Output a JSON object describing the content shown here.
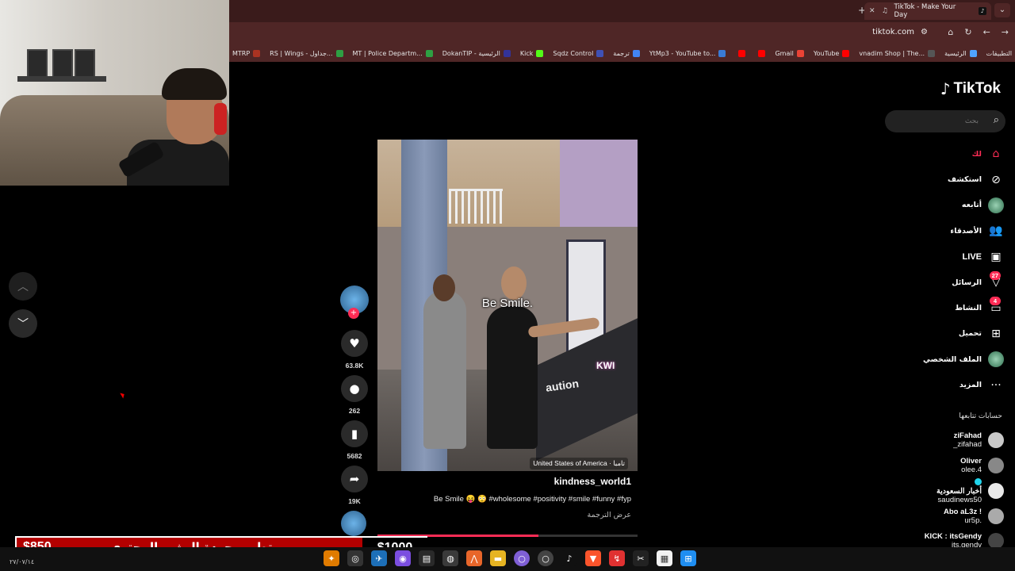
{
  "browser": {
    "tab_title": "TikTok - Make Your Day",
    "url": "tiktok.com",
    "bookmarks": [
      {
        "label": "التطبيقات",
        "color": "#8888ff"
      },
      {
        "label": "الرئيسية",
        "color": "#4fa3ff"
      },
      {
        "label": "vnadim Shop | The...",
        "color": "#555555"
      },
      {
        "label": "YouTube",
        "color": "#ff0000"
      },
      {
        "label": "Gmail",
        "color": "#ea4335"
      },
      {
        "label": "",
        "color": "#ff0000"
      },
      {
        "label": "",
        "color": "#ff0000"
      },
      {
        "label": "YtMp3 - YouTube to...",
        "color": "#3a7bd5"
      },
      {
        "label": "ترجمة",
        "color": "#4285f4"
      },
      {
        "label": "Sqdz Control",
        "color": "#3f51b5"
      },
      {
        "label": "Kick",
        "color": "#53fc18"
      },
      {
        "label": "DokanTIP - الرئيسية",
        "color": "#333399"
      },
      {
        "label": "MT | Police Departm...",
        "color": "#2ea043"
      },
      {
        "label": "RS | Wings - جداول...",
        "color": "#2ea043"
      },
      {
        "label": "MTRP",
        "color": "#aa3322"
      }
    ]
  },
  "video": {
    "caption_overlay": "Be Smile.",
    "watermark": "KWI",
    "sign_text": "aution",
    "location": "United States of America · تامبا",
    "author": "kindness_world1",
    "description": "Be Smile 😝 😳 #wholesome #positivity #smile #funny #fyp",
    "translate": "عرض الترجمة",
    "progress": 0.62
  },
  "actions": {
    "likes": "63.8K",
    "comments": "262",
    "saves": "5682",
    "shares": "19K"
  },
  "sidebar": {
    "logo": "TikTok",
    "search_placeholder": "بحث",
    "nav": [
      {
        "label": "لك",
        "icon": "home-icon",
        "glyph": "⌂",
        "active": true
      },
      {
        "label": "استكشف",
        "icon": "compass-icon",
        "glyph": "⊘"
      },
      {
        "label": "أتابعه",
        "icon": "following-avatar-icon",
        "glyph": ""
      },
      {
        "label": "الأصدقاء",
        "icon": "friends-icon",
        "glyph": "👥"
      },
      {
        "label": "LIVE",
        "icon": "live-icon",
        "glyph": "▣"
      },
      {
        "label": "الرسائل",
        "icon": "messages-icon",
        "glyph": "▽",
        "badge": "27"
      },
      {
        "label": "النشاط",
        "icon": "activity-icon",
        "glyph": "▭",
        "badge": "4"
      },
      {
        "label": "تحميل",
        "icon": "upload-icon",
        "glyph": "⊞"
      },
      {
        "label": "الملف الشخصي",
        "icon": "profile-avatar-icon",
        "glyph": ""
      },
      {
        "label": "المزيد",
        "icon": "more-icon",
        "glyph": "···"
      }
    ],
    "following_title": "حسابات تتابعها",
    "accounts": [
      {
        "name": "ziFahad",
        "handle": "_zifahad",
        "color": "#c9c9c9"
      },
      {
        "name": "Oliver",
        "handle": "olee.4",
        "color": "#888888"
      },
      {
        "name": "أخبار السعودية",
        "handle": "saudinews50",
        "color": "#e8e8e8",
        "verified": true
      },
      {
        "name": "Abo aL3z !",
        "handle": "ur5p.",
        "color": "#aaaaaa"
      },
      {
        "name": "KICK : itsGendy",
        "handle": "its.gendy",
        "color": "#444444"
      }
    ]
  },
  "banner": {
    "price_left": "$850",
    "title": "تطوير جودة البث و المحتوى",
    "price_right": "$1000"
  },
  "taskbar": {
    "date": "٢٧/٠٧/١٤"
  }
}
